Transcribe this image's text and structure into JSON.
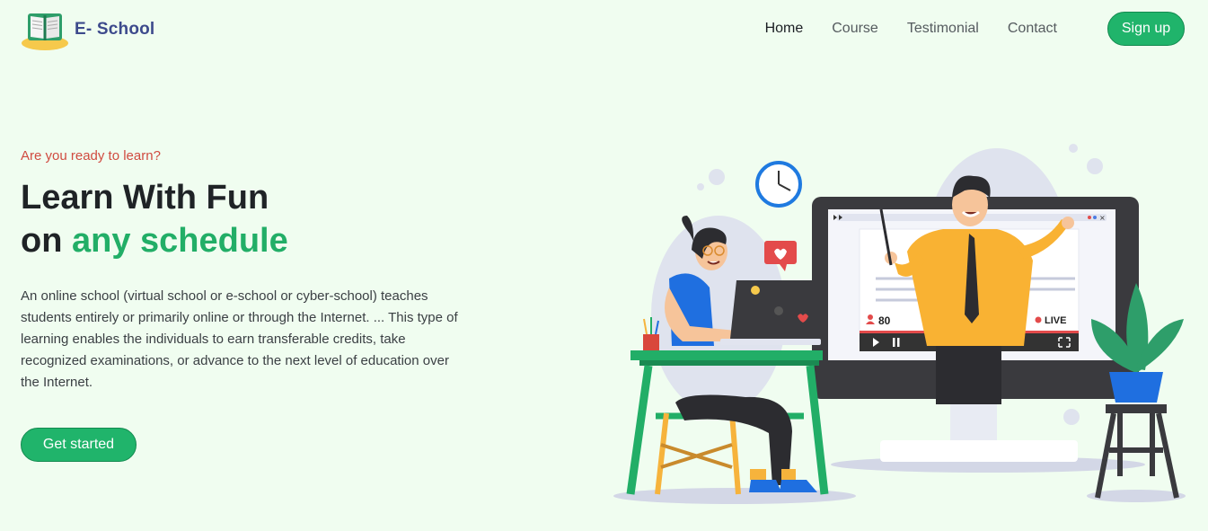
{
  "brand": {
    "name": "E- School",
    "logo_icon": "open-book-icon"
  },
  "nav": {
    "items": [
      {
        "label": "Home",
        "active": true
      },
      {
        "label": "Course",
        "active": false
      },
      {
        "label": "Testimonial",
        "active": false
      },
      {
        "label": "Contact",
        "active": false
      }
    ],
    "signup_label": "Sign up"
  },
  "hero": {
    "eyebrow": "Are you ready to learn?",
    "headline_line1": "Learn With Fun",
    "headline_line2_prefix": "on ",
    "headline_line2_accent": "any schedule",
    "description": "An online school (virtual school or e-school or cyber-school) teaches students entirely or primarily online or through the Internet. ... This type of learning enables the individuals to earn transferable credits, take recognized examinations, or advance to the next level of education over the Internet.",
    "cta_label": "Get started"
  },
  "illustration": {
    "viewers": "80",
    "live_label": "LIVE"
  },
  "colors": {
    "background": "#f0fdf0",
    "accent": "#20b46b",
    "eyebrow": "#d04b40",
    "brand_text": "#3d4a8c"
  }
}
